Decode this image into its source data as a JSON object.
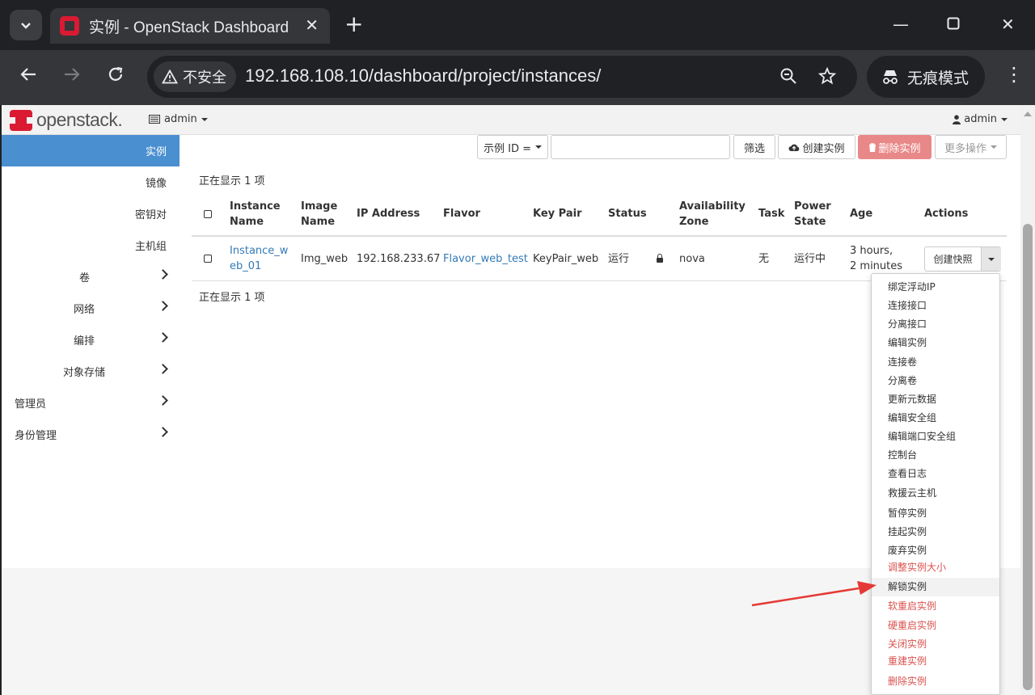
{
  "browser": {
    "tab_title": "实例 - OpenStack Dashboard",
    "security_label": "不安全",
    "url": "192.168.108.10/dashboard/project/instances/",
    "incognito_label": "无痕模式"
  },
  "header": {
    "logo_text": "openstack.",
    "project_label": "admin",
    "user_label": "admin"
  },
  "sidebar": {
    "sub_items": [
      {
        "label": "实例",
        "active": true
      },
      {
        "label": "镜像"
      },
      {
        "label": "密钥对"
      },
      {
        "label": "主机组"
      }
    ],
    "sections": [
      {
        "label": "卷"
      },
      {
        "label": "网络"
      },
      {
        "label": "编排"
      },
      {
        "label": "对象存储"
      }
    ],
    "top_sections": [
      {
        "label": "管理员"
      },
      {
        "label": "身份管理"
      }
    ]
  },
  "filters": {
    "filter_field_label": "示例 ID =",
    "filter_button": "筛选",
    "create_button": "创建实例",
    "delete_button": "删除实例",
    "more_button": "更多操作"
  },
  "summary": {
    "top": "正在显示 1 项",
    "bottom": "正在显示 1 项"
  },
  "table": {
    "headers": {
      "name_1": "Instance",
      "name_2": "Name",
      "image_1": "Image",
      "image_2": "Name",
      "ip": "IP Address",
      "flavor": "Flavor",
      "keypair": "Key Pair",
      "status": "Status",
      "zone_1": "Availability",
      "zone_2": "Zone",
      "task": "Task",
      "power_1": "Power",
      "power_2": "State",
      "age": "Age",
      "actions": "Actions"
    },
    "rows": [
      {
        "name_1": "Instance_w",
        "name_2": "eb_01",
        "image": "Img_web",
        "ip": "192.168.233.67",
        "flavor": "Flavor_web_test",
        "keypair": "KeyPair_web",
        "status": "运行",
        "zone": "nova",
        "task": "无",
        "power": "运行中",
        "age_1": "3 hours,",
        "age_2": "2 minutes",
        "action_label": "创建快照"
      }
    ]
  },
  "actions_menu": [
    {
      "label": "绑定浮动IP",
      "danger": false
    },
    {
      "label": "连接接口",
      "danger": false
    },
    {
      "label": "分离接口",
      "danger": false
    },
    {
      "label": "编辑实例",
      "danger": false
    },
    {
      "label": "连接卷",
      "danger": false
    },
    {
      "label": "分离卷",
      "danger": false
    },
    {
      "label": "更新元数据",
      "danger": false
    },
    {
      "label": "编辑安全组",
      "danger": false
    },
    {
      "label": "编辑端口安全组",
      "danger": false
    },
    {
      "label": "控制台",
      "danger": false
    },
    {
      "label": "查看日志",
      "danger": false
    },
    {
      "label": "救援云主机",
      "danger": false
    },
    {
      "label": "暂停实例",
      "danger": false
    },
    {
      "label": "挂起实例",
      "danger": false
    },
    {
      "label": "废弃实例",
      "danger": false
    },
    {
      "label": "调整实例大小",
      "danger": true
    },
    {
      "label": "解锁实例",
      "danger": false,
      "highlighted": true
    },
    {
      "label": "软重启实例",
      "danger": true
    },
    {
      "label": "硬重启实例",
      "danger": true
    },
    {
      "label": "关闭实例",
      "danger": true
    },
    {
      "label": "重建实例",
      "danger": true
    },
    {
      "label": "删除实例",
      "danger": true
    }
  ],
  "colors": {
    "accent": "#4a8fd0",
    "danger": "#d9534f",
    "link": "#337ab7",
    "brand": "#da1a32",
    "annotation": "#e53935"
  }
}
